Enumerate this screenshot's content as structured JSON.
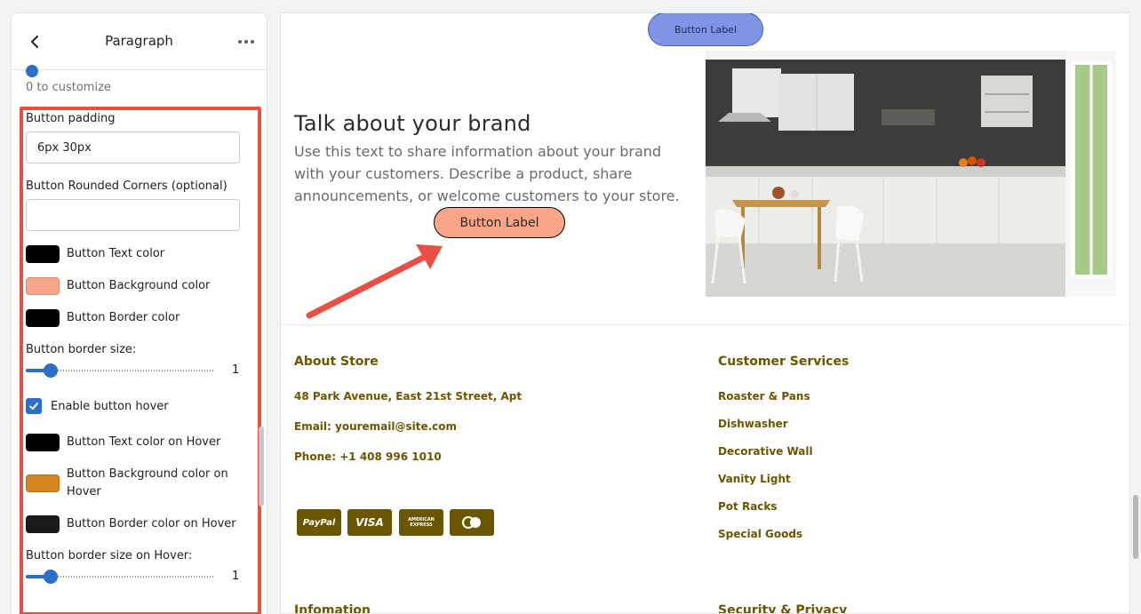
{
  "panel": {
    "title": "Paragraph",
    "prev_hint": "0 to customize",
    "button_padding": {
      "label": "Button padding",
      "value": "6px 30px"
    },
    "rounded_corners": {
      "label": "Button Rounded Corners (optional)",
      "value": ""
    },
    "colors": [
      {
        "label": "Button Text color",
        "color": "#000000"
      },
      {
        "label": "Button Background color",
        "color": "#f9a688"
      },
      {
        "label": "Button Border color",
        "color": "#000000"
      }
    ],
    "border_size": {
      "label": "Button border size:",
      "value": "1",
      "fraction": 0.13
    },
    "hover_checkbox": {
      "label": "Enable button hover",
      "checked": true
    },
    "hover_colors": [
      {
        "label": "Button Text color on Hover",
        "color": "#000000"
      },
      {
        "label": "Button Background color on Hover",
        "color": "#d6861f"
      },
      {
        "label": "Button Border color on Hover",
        "color": "#1a1a1a"
      }
    ],
    "hover_border_size": {
      "label": "Button border size on Hover:",
      "value": "1",
      "fraction": 0.13
    }
  },
  "preview": {
    "top_button_label": "Button Label",
    "hero": {
      "heading": "Talk about your brand",
      "text": "Use this text to share information about your brand with your customers. Describe a product, share announcements, or welcome customers to your store.",
      "button_label": "Button Label"
    },
    "footer": {
      "about": {
        "heading": "About Store",
        "address": "48 Park Avenue, East 21st Street, Apt",
        "email": "Email: youremail@site.com",
        "phone": "Phone: +1 408 996 1010"
      },
      "payment_icons": [
        {
          "name": "paypal-icon",
          "text": "PayPal"
        },
        {
          "name": "visa-icon",
          "text": "VISA"
        },
        {
          "name": "amex-icon",
          "text": "AMERICAN EXPRESS"
        },
        {
          "name": "mastercard-icon",
          "text": ""
        }
      ],
      "services": {
        "heading": "Customer Services",
        "links": [
          "Roaster & Pans",
          "Dishwasher",
          "Decorative Wall",
          "Vanity Light",
          "Pot Racks",
          "Special Goods"
        ]
      },
      "info_heading": "Infomation",
      "security_heading": "Security & Privacy"
    }
  }
}
